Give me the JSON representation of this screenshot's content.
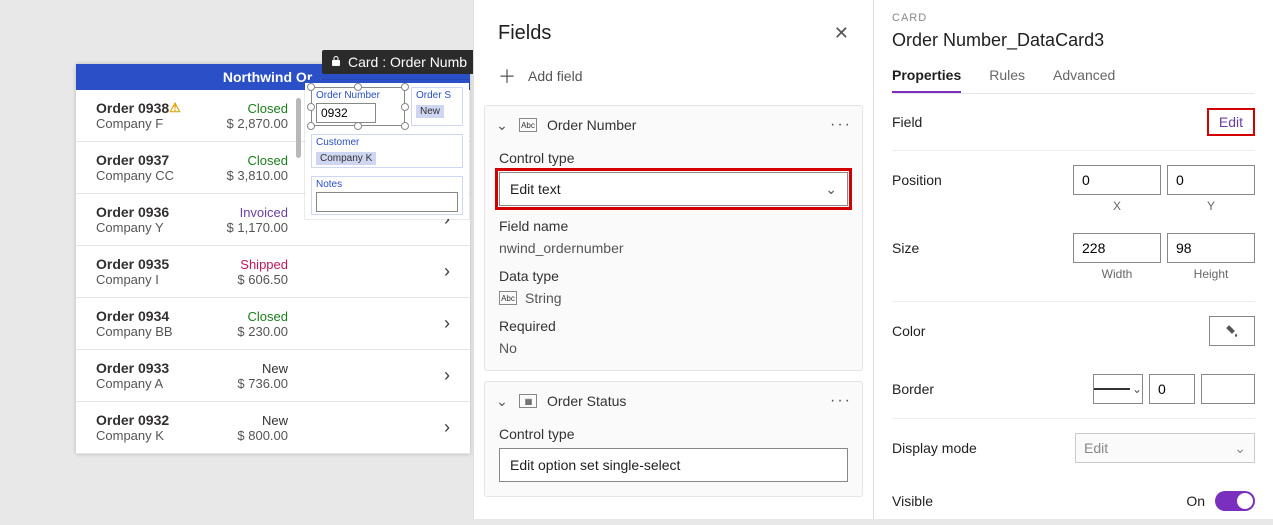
{
  "canvas": {
    "header": "Northwind Or...",
    "tooltip": "Card : Order Numb",
    "orders": [
      {
        "name": "Order 0938",
        "company": "Company F",
        "status": "Closed",
        "amount": "$ 2,870.00",
        "warn": true
      },
      {
        "name": "Order 0937",
        "company": "Company CC",
        "status": "Closed",
        "amount": "$ 3,810.00"
      },
      {
        "name": "Order 0936",
        "company": "Company Y",
        "status": "Invoiced",
        "amount": "$ 1,170.00"
      },
      {
        "name": "Order 0935",
        "company": "Company I",
        "status": "Shipped",
        "amount": "$ 606.50"
      },
      {
        "name": "Order 0934",
        "company": "Company BB",
        "status": "Closed",
        "amount": "$ 230.00"
      },
      {
        "name": "Order 0933",
        "company": "Company A",
        "status": "New",
        "amount": "$ 736.00"
      },
      {
        "name": "Order 0932",
        "company": "Company K",
        "status": "New",
        "amount": "$ 800.00"
      }
    ],
    "card": {
      "orderNumLabel": "Order Number",
      "orderNumValue": "0932",
      "orderStatusLabel": "Order S",
      "orderStatusValue": "New",
      "customerLabel": "Customer",
      "customerValue": "Company K",
      "notesLabel": "Notes",
      "notesValue": ""
    }
  },
  "fieldsPanel": {
    "title": "Fields",
    "addField": "Add field",
    "cards": [
      {
        "icon": "abc",
        "name": "Order Number",
        "controlTypeLabel": "Control type",
        "controlType": "Edit text",
        "fieldNameLabel": "Field name",
        "fieldName": "nwind_ordernumber",
        "dataTypeLabel": "Data type",
        "dataType": "String",
        "requiredLabel": "Required",
        "required": "No"
      },
      {
        "icon": "grid",
        "name": "Order Status",
        "controlTypeLabel": "Control type",
        "controlType": "Edit option set single-select"
      }
    ]
  },
  "props": {
    "crumb": "CARD",
    "name": "Order Number_DataCard3",
    "tabs": [
      "Properties",
      "Rules",
      "Advanced"
    ],
    "fieldLabel": "Field",
    "editLink": "Edit",
    "positionLabel": "Position",
    "position": {
      "x": "0",
      "y": "0",
      "xl": "X",
      "yl": "Y"
    },
    "sizeLabel": "Size",
    "size": {
      "w": "228",
      "h": "98",
      "wl": "Width",
      "hl": "Height"
    },
    "colorLabel": "Color",
    "borderLabel": "Border",
    "borderWidth": "0",
    "displayModeLabel": "Display mode",
    "displayMode": "Edit",
    "visibleLabel": "Visible",
    "visibleState": "On"
  }
}
